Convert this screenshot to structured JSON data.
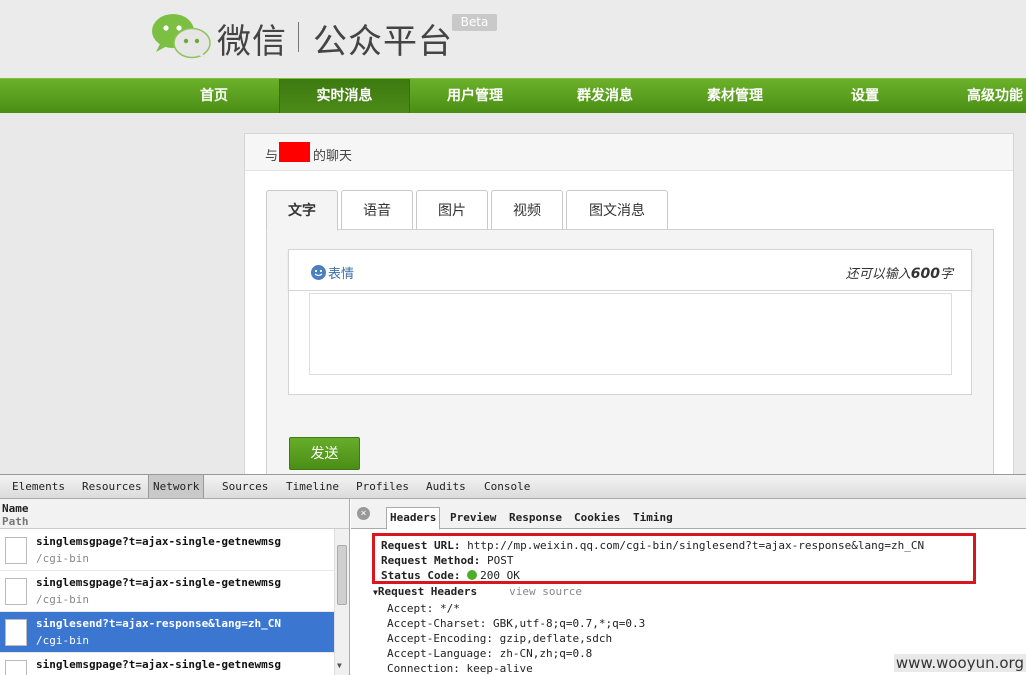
{
  "header": {
    "logo_text": "微信",
    "logo_sub": "公众平台",
    "beta_badge": "Beta"
  },
  "nav": {
    "items": [
      "首页",
      "实时消息",
      "用户管理",
      "群发消息",
      "素材管理",
      "设置",
      "高级功能"
    ],
    "active": "实时消息"
  },
  "chat": {
    "title_prefix": "与",
    "title_suffix": "的聊天"
  },
  "composer": {
    "tabs": [
      "文字",
      "语音",
      "图片",
      "视频",
      "图文消息"
    ],
    "active_tab": "文字",
    "emoji_label": "表情",
    "char_left_prefix": "还可以输入",
    "char_left_count": "600",
    "char_left_suffix": "字",
    "send_label": "发送"
  },
  "devtools": {
    "tabs": [
      "Elements",
      "Resources",
      "Network",
      "Sources",
      "Timeline",
      "Profiles",
      "Audits",
      "Console"
    ],
    "active_tab": "Network",
    "list_header_name": "Name",
    "list_header_path": "Path",
    "requests": [
      {
        "name": "singlemsgpage?t=ajax-single-getnewmsg",
        "path": "/cgi-bin",
        "selected": false
      },
      {
        "name": "singlemsgpage?t=ajax-single-getnewmsg",
        "path": "/cgi-bin",
        "selected": false
      },
      {
        "name": "singlesend?t=ajax-response&lang=zh_CN",
        "path": "/cgi-bin",
        "selected": true
      },
      {
        "name": "singlemsgpage?t=ajax-single-getnewmsg",
        "path": "",
        "selected": false
      }
    ],
    "detail_tabs": [
      "Headers",
      "Preview",
      "Response",
      "Cookies",
      "Timing"
    ],
    "active_detail_tab": "Headers",
    "request_url_label": "Request URL:",
    "request_url": "http://mp.weixin.qq.com/cgi-bin/singlesend?t=ajax-response&lang=zh_CN",
    "request_method_label": "Request Method:",
    "request_method": "POST",
    "status_code_label": "Status Code:",
    "status_code": "200 OK",
    "request_headers_label": "Request Headers",
    "view_source": "view source",
    "headers": [
      {
        "key": "Accept:",
        "value": "*/*"
      },
      {
        "key": "Accept-Charset:",
        "value": "GBK,utf-8;q=0.7,*;q=0.3"
      },
      {
        "key": "Accept-Encoding:",
        "value": "gzip,deflate,sdch"
      },
      {
        "key": "Accept-Language:",
        "value": "zh-CN,zh;q=0.8"
      },
      {
        "key": "Connection:",
        "value": "keep-alive"
      }
    ]
  },
  "watermark": "www.wooyun.org",
  "colors": {
    "nav_green": "#5a9e1e",
    "highlight_red": "#d9161e",
    "selected_row": "#3b77d0"
  }
}
